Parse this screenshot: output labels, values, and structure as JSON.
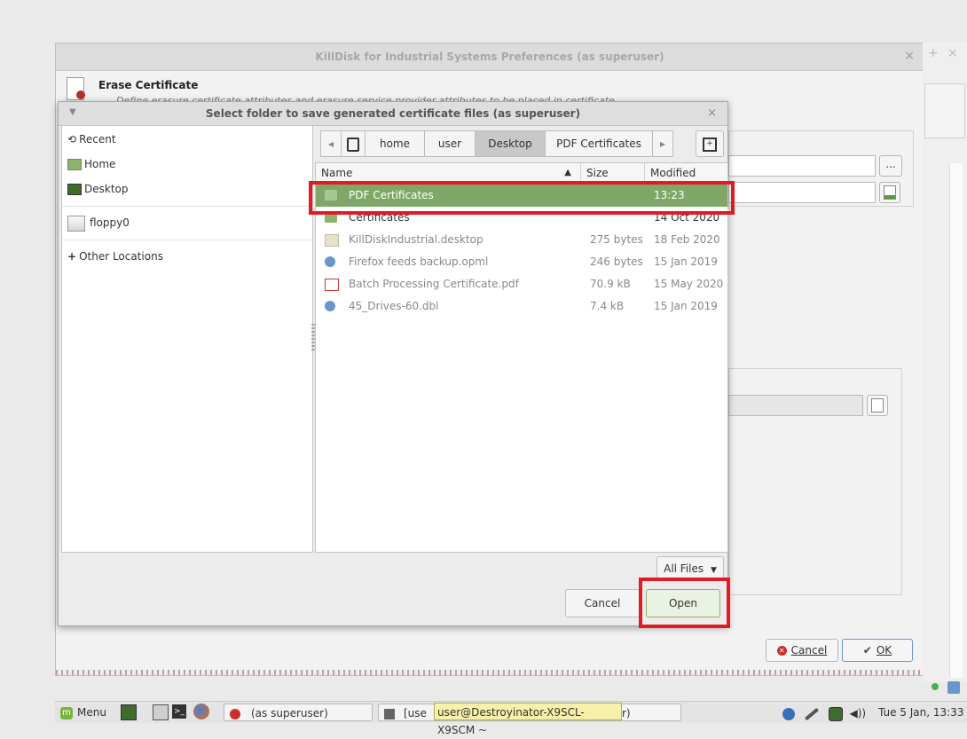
{
  "background_window": {
    "title": "KillDisk for Industrial Systems Preferences (as superuser)",
    "close_glyph": "×",
    "header_title": "Erase Certificate",
    "header_desc": "Define erasure certificate attributes and erasure service provider attributes to be placed in certificate",
    "browse_label": "...",
    "cancel_label": "Cancel",
    "ok_label": "OK"
  },
  "dialog": {
    "title": "Select folder to save generated certificate files (as superuser)",
    "close_glyph": "×",
    "sidebar": [
      {
        "icon": "history-icon",
        "label": "Recent"
      },
      {
        "icon": "home-icon",
        "label": "Home"
      },
      {
        "icon": "desktop-icon",
        "label": "Desktop"
      },
      {
        "icon": "drive-icon",
        "label": "floppy0"
      },
      {
        "icon": "plus-icon",
        "label": "Other Locations"
      }
    ],
    "breadcrumbs": [
      "home",
      "user",
      "Desktop",
      "PDF Certificates"
    ],
    "active_crumb": "Desktop",
    "columns": {
      "name": "Name",
      "size": "Size",
      "modified": "Modified"
    },
    "files": [
      {
        "name": "PDF Certificates",
        "size": "",
        "modified": "13:23",
        "icon": "folder-icon",
        "selected": true
      },
      {
        "name": "Certificates",
        "size": "",
        "modified": "14 Oct 2020",
        "icon": "folder-icon",
        "selected": false
      },
      {
        "name": "KillDiskIndustrial.desktop",
        "size": "275 bytes",
        "modified": "18 Feb 2020",
        "icon": "desktop-file-icon",
        "selected": false
      },
      {
        "name": "Firefox feeds backup.opml",
        "size": "246 bytes",
        "modified": "15 Jan 2019",
        "icon": "globe-icon",
        "selected": false
      },
      {
        "name": "Batch Processing Certificate.pdf",
        "size": "70.9 kB",
        "modified": "15 May 2020",
        "icon": "pdf-icon",
        "selected": false
      },
      {
        "name": "45_Drives-60.dbl",
        "size": "7.4 kB",
        "modified": "15 Jan 2019",
        "icon": "globe-icon",
        "selected": false
      }
    ],
    "filter_label": "All Files",
    "cancel_label": "Cancel",
    "open_label": "Open"
  },
  "taskbar": {
    "menu_label": "Menu",
    "window1_label": "(as superuser)",
    "window2_label": "[use",
    "window2_tail": "r)",
    "tooltip": "user@Destroyinator-X9SCL-X9SCM ~",
    "clock": "Tue  5 Jan, 13:33"
  },
  "colors": {
    "accent": "#7fa868",
    "highlight": "#e21a22"
  }
}
